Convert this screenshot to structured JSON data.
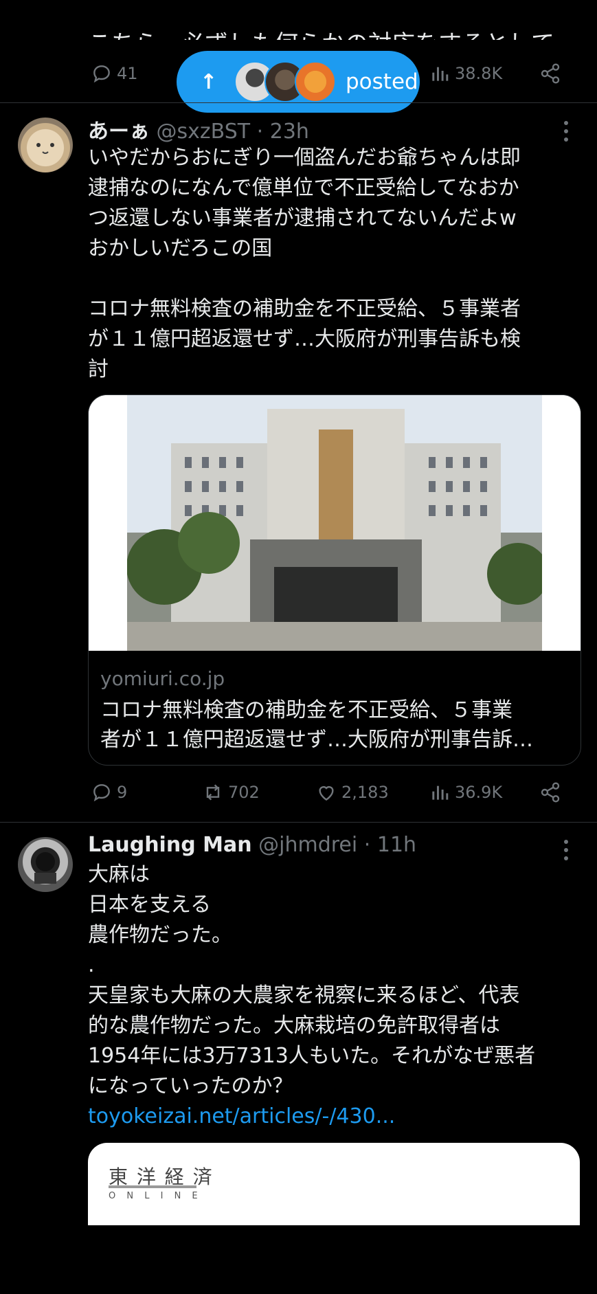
{
  "top_tweet": {
    "cut_text": "こちら、必ずしも何らかの対応をするとしても",
    "actions": {
      "replies": "41",
      "views": "38.8K"
    }
  },
  "posted_pill": {
    "label": "posted",
    "arrow": "↑"
  },
  "tweet1": {
    "name": "あーぁ",
    "handle": "@sxzBST",
    "time": "23h",
    "text_lines": [
      "いやだからおにぎり一個盗んだお爺ちゃんは即",
      "逮捕なのになんで億単位で不正受給してなおか",
      "つ返還しない事業者が逮捕されてないんだよw",
      "おかしいだろこの国",
      "",
      "コロナ無料検査の補助金を不正受給、５事業者",
      "が１１億円超返還せず…大阪府が刑事告訴も検",
      "討"
    ],
    "card": {
      "domain": "yomiuri.co.jp",
      "title_line1": "コロナ無料検査の補助金を不正受給、５事業",
      "title_line2": "者が１１億円超返還せず…大阪府が刑事告訴…"
    },
    "actions": {
      "replies": "9",
      "reposts": "702",
      "likes": "2,183",
      "views": "36.9K"
    }
  },
  "tweet2": {
    "name": "Laughing Man",
    "handle": "@jhmdrei",
    "time": "11h",
    "text_lines": [
      "大麻は",
      "日本を支える",
      "農作物だった。",
      ".",
      "天皇家も大麻の大農家を視察に来るほど、代表",
      "的な農作物だった。大麻栽培の免許取得者は",
      "1954年には3万7313人もいた。それがなぜ悪者",
      "になっていったのか？"
    ],
    "link": "toyokeizai.net/articles/-/430...",
    "card": {
      "logo_top": "東 洋 経 済",
      "logo_bottom": "O N L I N E"
    }
  },
  "icons": [
    "reply-icon",
    "repost-icon",
    "like-icon",
    "views-icon",
    "share-icon",
    "more-icon"
  ],
  "colors": {
    "accent": "#1d9bf0",
    "muted": "#71767b",
    "divider": "#2f3336"
  }
}
